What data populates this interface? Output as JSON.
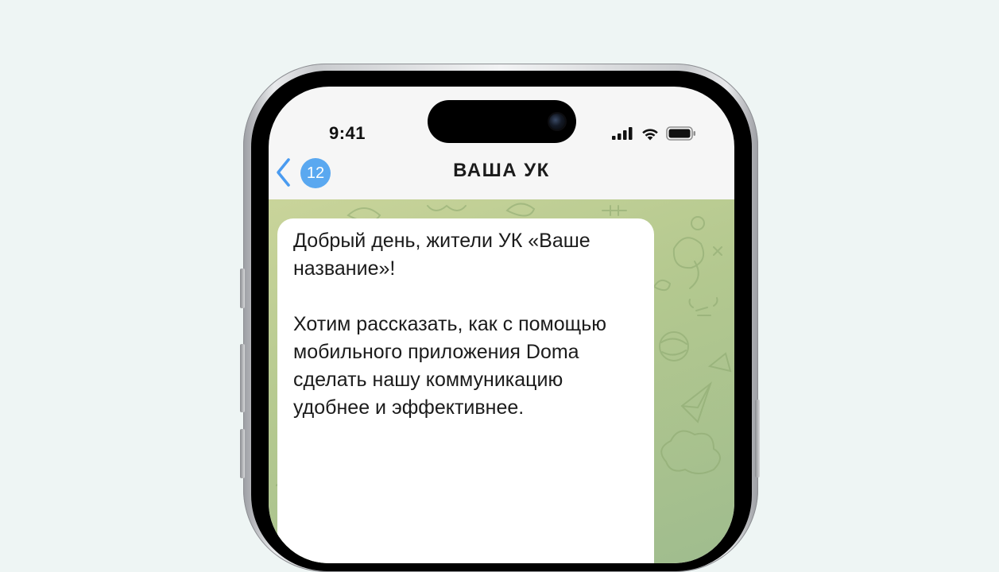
{
  "status_bar": {
    "time": "9:41",
    "icons": [
      "cellular-signal-icon",
      "wifi-icon",
      "battery-icon"
    ]
  },
  "chat_header": {
    "back_icon": "chevron-left-icon",
    "unread_count": "12",
    "title": "ВАША УК"
  },
  "message": {
    "paragraphs": [
      "Добрый день, жители УК «Ваше название»!",
      "Хотим рассказать, как с помощью мобильного приложения Doma сделать нашу коммуникацию удобнее и эффективнее."
    ]
  },
  "colors": {
    "page_background": "#eef5f4",
    "accent_blue": "#5aa8f0",
    "chat_wallpaper": "#b3c88f",
    "bubble": "#ffffff"
  }
}
